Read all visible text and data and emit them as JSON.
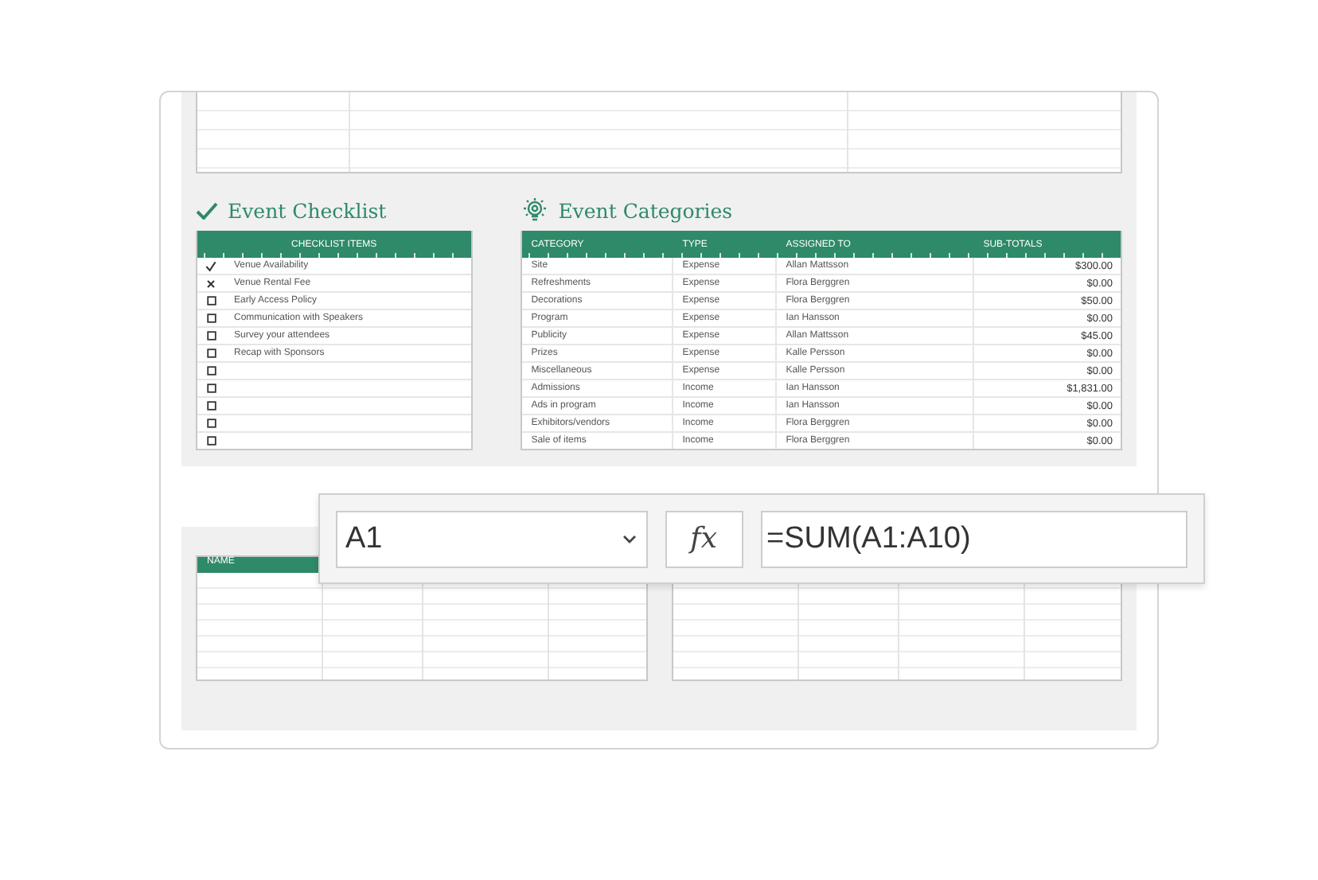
{
  "checklist": {
    "title": "Event Checklist",
    "column": "CHECKLIST ITEMS",
    "items": [
      {
        "kind": "check",
        "label": "Venue Availability"
      },
      {
        "kind": "cross",
        "label": "Venue Rental Fee"
      },
      {
        "kind": "box",
        "label": "Early Access Policy"
      },
      {
        "kind": "box",
        "label": "Communication with Speakers"
      },
      {
        "kind": "box",
        "label": "Survey your attendees"
      },
      {
        "kind": "box",
        "label": "Recap with Sponsors"
      },
      {
        "kind": "box"
      },
      {
        "kind": "box"
      },
      {
        "kind": "box"
      },
      {
        "kind": "box"
      },
      {
        "kind": "box"
      }
    ]
  },
  "categories": {
    "title": "Event Categories",
    "columns": [
      "CATEGORY",
      "TYPE",
      "ASSIGNED TO",
      "SUB-TOTALS"
    ],
    "rows": [
      [
        "Site",
        "Expense",
        "Allan Mattsson",
        "$300.00"
      ],
      [
        "Refreshments",
        "Expense",
        "Flora Berggren",
        "$0.00"
      ],
      [
        "Decorations",
        "Expense",
        "Flora Berggren",
        "$50.00"
      ],
      [
        "Program",
        "Expense",
        "Ian Hansson",
        "$0.00"
      ],
      [
        "Publicity",
        "Expense",
        "Allan Mattsson",
        "$45.00"
      ],
      [
        "Prizes",
        "Expense",
        "Kalle Persson",
        "$0.00"
      ],
      [
        "Miscellaneous",
        "Expense",
        "Kalle Persson",
        "$0.00"
      ],
      [
        "Admissions",
        "Income",
        "Ian Hansson",
        "$1,831.00"
      ],
      [
        "Ads in program",
        "Income",
        "Ian Hansson",
        "$0.00"
      ],
      [
        "Exhibitors/vendors",
        "Income",
        "Flora Berggren",
        "$0.00"
      ],
      [
        "Sale of items",
        "Income",
        "Flora Berggren",
        "$0.00"
      ]
    ]
  },
  "name_table": {
    "columns": [
      "NAME"
    ]
  },
  "formula_bar": {
    "name_box": "A1",
    "function_label": "fx",
    "formula": "=SUM(A1:A10)"
  }
}
